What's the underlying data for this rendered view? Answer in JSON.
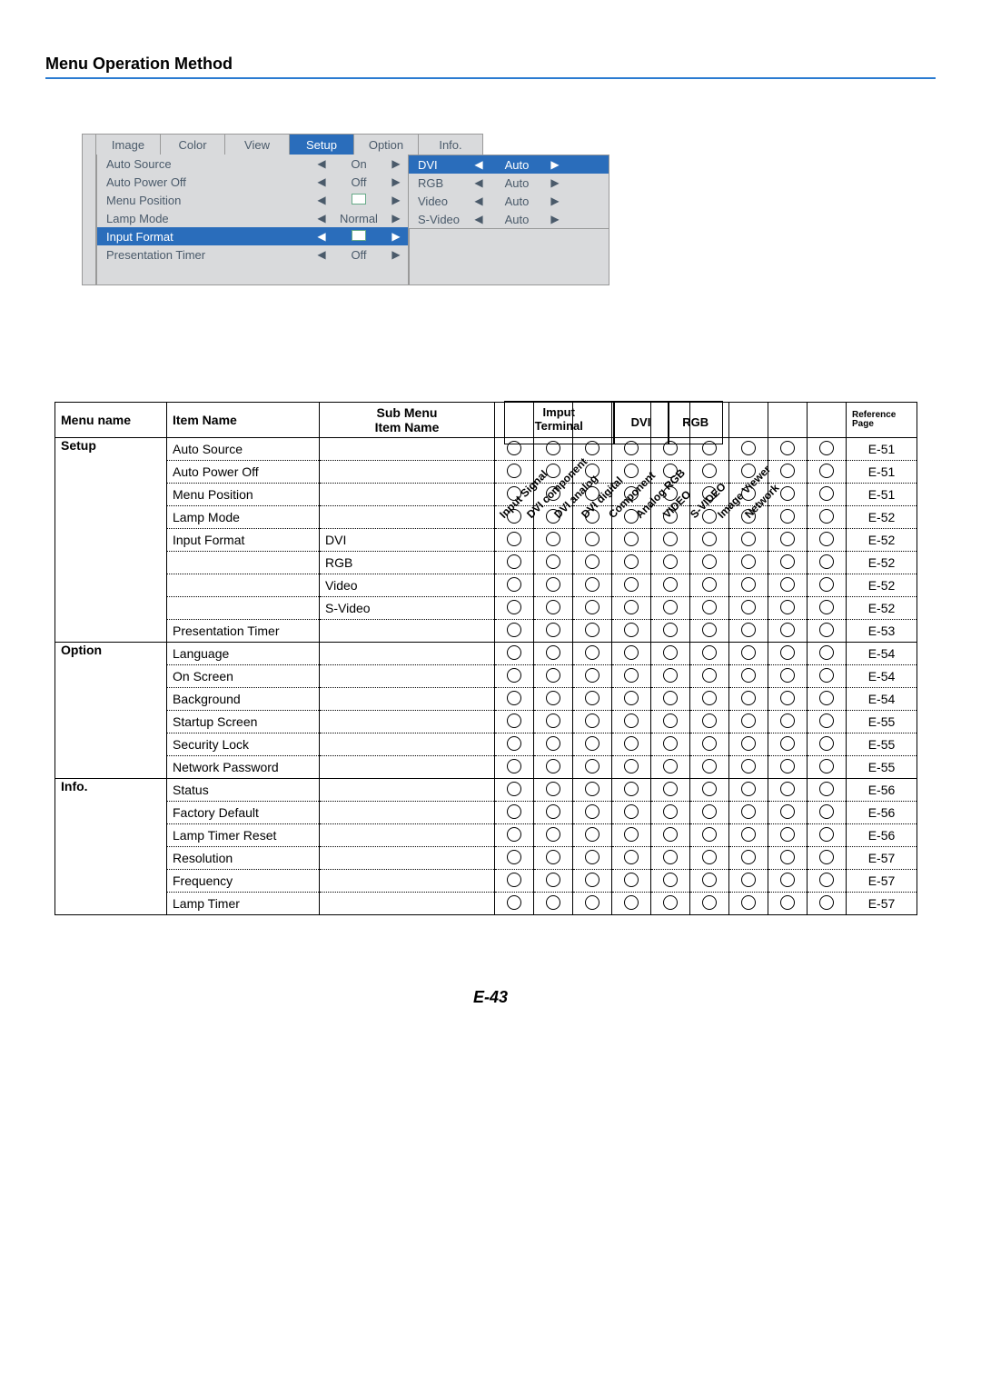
{
  "page_title": "Menu Operation Method",
  "footer": "E-43",
  "tabs": [
    "Image",
    "Color",
    "View",
    "Setup",
    "Option",
    "Info."
  ],
  "tab_active": "Setup",
  "setup_rows": [
    {
      "label": "Auto Source",
      "val": "On",
      "hl": false,
      "sprite": false
    },
    {
      "label": "Auto Power Off",
      "val": "Off",
      "hl": false,
      "sprite": false
    },
    {
      "label": "Menu Position",
      "val": "",
      "hl": false,
      "sprite": true
    },
    {
      "label": "Lamp Mode",
      "val": "Normal",
      "hl": false,
      "sprite": false
    },
    {
      "label": "Input Format",
      "val": "",
      "hl": true,
      "sprite": true
    },
    {
      "label": "Presentation Timer",
      "val": "Off",
      "hl": false,
      "sprite": false
    }
  ],
  "submenu_rows": [
    {
      "label": "DVI",
      "val": "Auto",
      "hl": true
    },
    {
      "label": "RGB",
      "val": "Auto",
      "hl": false
    },
    {
      "label": "Video",
      "val": "Auto",
      "hl": false
    },
    {
      "label": "S-Video",
      "val": "Auto",
      "hl": false
    }
  ],
  "group_headers": {
    "g1": "Imput\nTerminal",
    "g2": "DVI",
    "g3": "RGB"
  },
  "diag_headers": [
    "Input Signal",
    "DVI component",
    "DVI analog",
    "DVI digital",
    "Component",
    "Analog RGB",
    "VIDEO",
    "S-VIDEO",
    "Image Viewer",
    "Network"
  ],
  "table_head": {
    "menu": "Menu name",
    "item": "Item Name",
    "sub": "Sub Menu\nItem Name",
    "ref": "Reference\nPage"
  },
  "rows": [
    {
      "menu": "Setup",
      "item": "Auto Source",
      "sub": "",
      "ref": "E-51",
      "first": true
    },
    {
      "menu": "",
      "item": "Auto Power Off",
      "sub": "",
      "ref": "E-51"
    },
    {
      "menu": "",
      "item": "Menu Position",
      "sub": "",
      "ref": "E-51"
    },
    {
      "menu": "",
      "item": "Lamp Mode",
      "sub": "",
      "ref": "E-52"
    },
    {
      "menu": "",
      "item": "Input Format",
      "sub": "DVI",
      "ref": "E-52"
    },
    {
      "menu": "",
      "item": "",
      "sub": "RGB",
      "ref": "E-52"
    },
    {
      "menu": "",
      "item": "",
      "sub": "Video",
      "ref": "E-52"
    },
    {
      "menu": "",
      "item": "",
      "sub": "S-Video",
      "ref": "E-52"
    },
    {
      "menu": "",
      "item": "Presentation Timer",
      "sub": "",
      "ref": "E-53",
      "groupend": true
    },
    {
      "menu": "Option",
      "item": "Language",
      "sub": "",
      "ref": "E-54",
      "first": true
    },
    {
      "menu": "",
      "item": "On Screen",
      "sub": "",
      "ref": "E-54"
    },
    {
      "menu": "",
      "item": "Background",
      "sub": "",
      "ref": "E-54"
    },
    {
      "menu": "",
      "item": "Startup Screen",
      "sub": "",
      "ref": "E-55"
    },
    {
      "menu": "",
      "item": "Security Lock",
      "sub": "",
      "ref": "E-55"
    },
    {
      "menu": "",
      "item": "Network Password",
      "sub": "",
      "ref": "E-55",
      "groupend": true
    },
    {
      "menu": "Info.",
      "item": "Status",
      "sub": "",
      "ref": "E-56",
      "first": true
    },
    {
      "menu": "",
      "item": "Factory Default",
      "sub": "",
      "ref": "E-56"
    },
    {
      "menu": "",
      "item": "Lamp Timer Reset",
      "sub": "",
      "ref": "E-56"
    },
    {
      "menu": "",
      "item": "Resolution",
      "sub": "",
      "ref": "E-57"
    },
    {
      "menu": "",
      "item": "Frequency",
      "sub": "",
      "ref": "E-57"
    },
    {
      "menu": "",
      "item": "Lamp Timer",
      "sub": "",
      "ref": "E-57",
      "last": true
    }
  ]
}
